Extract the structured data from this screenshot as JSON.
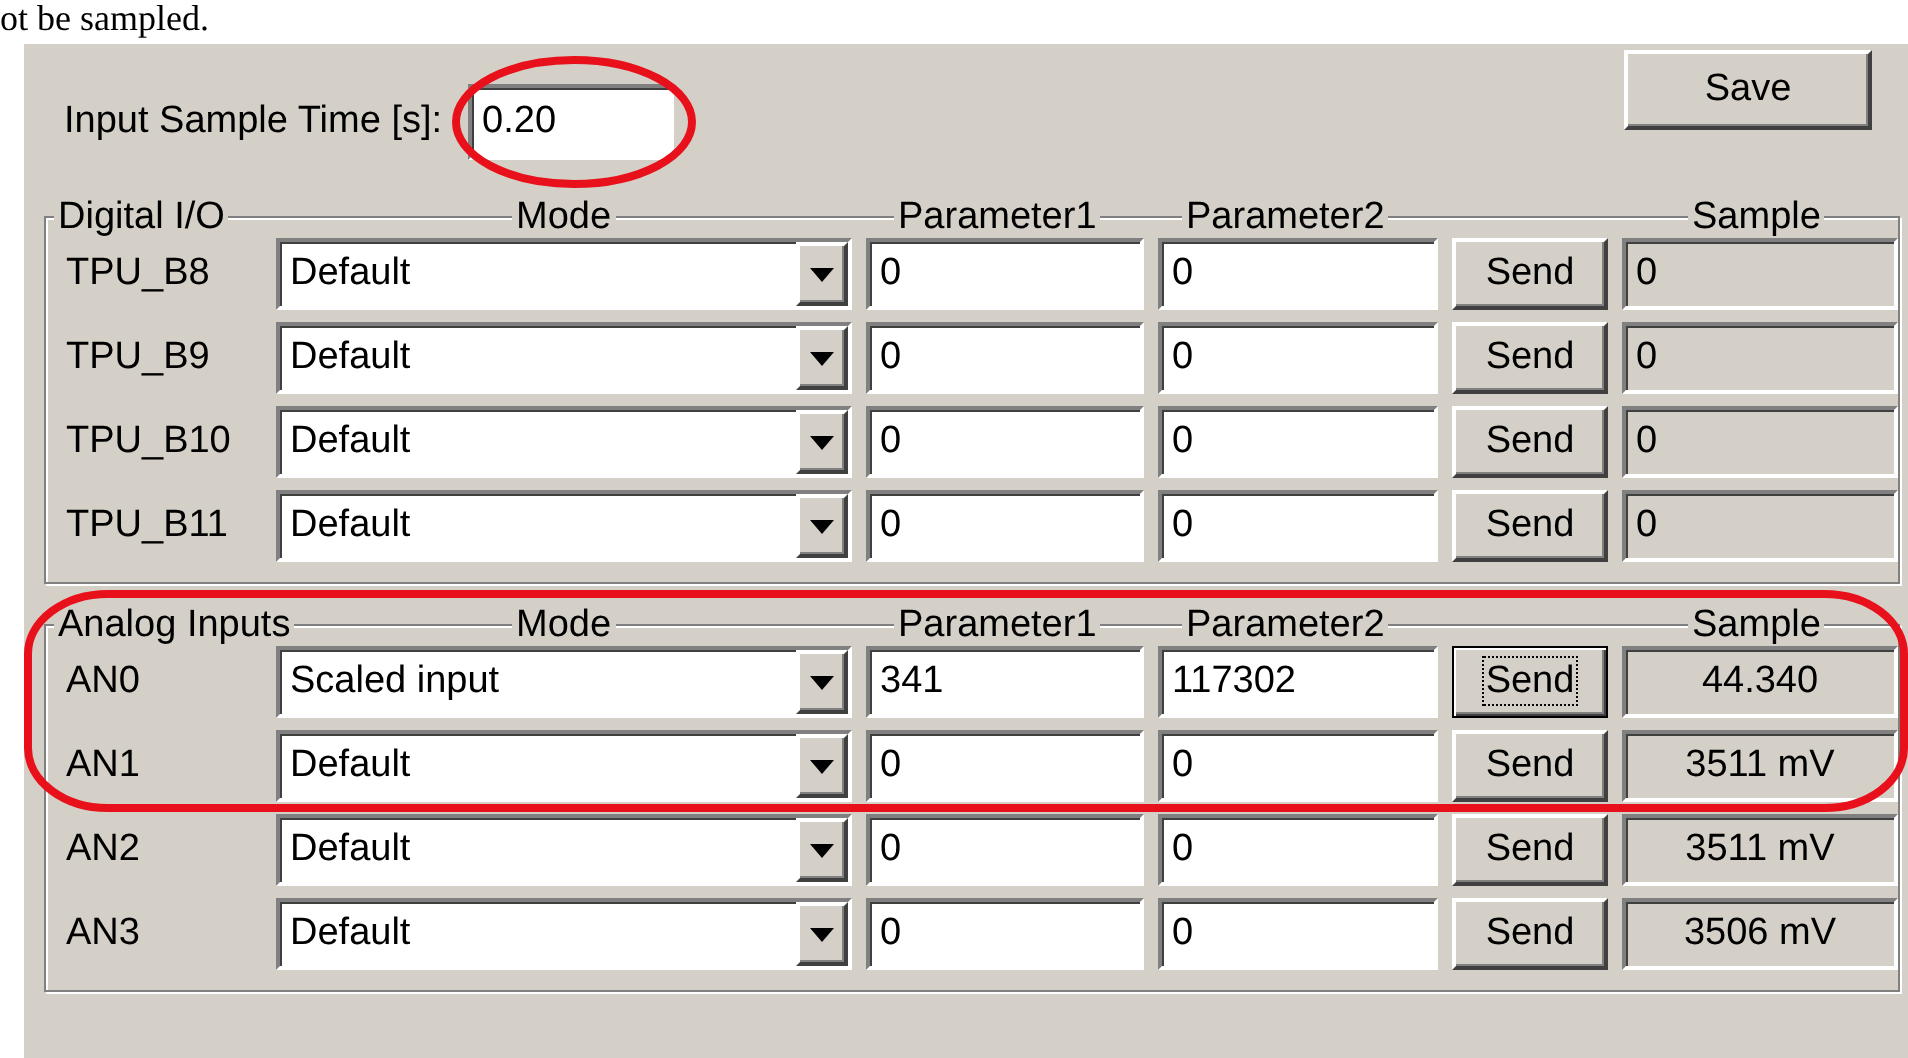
{
  "document_text": "ot be sampled.",
  "sample_time": {
    "label": "Input Sample Time [s]:",
    "value": "0.20"
  },
  "save_button": "Save",
  "groups": [
    {
      "kind": "digital",
      "title": "Digital I/O",
      "headers": [
        "Mode",
        "Parameter1",
        "Parameter2",
        "Sample"
      ],
      "rows": [
        {
          "label": "TPU_B8",
          "mode": "Default",
          "parameter1": "0",
          "parameter2": "0",
          "button": "Send",
          "focused": false,
          "sample": "0"
        },
        {
          "label": "TPU_B9",
          "mode": "Default",
          "parameter1": "0",
          "parameter2": "0",
          "button": "Send",
          "focused": false,
          "sample": "0"
        },
        {
          "label": "TPU_B10",
          "mode": "Default",
          "parameter1": "0",
          "parameter2": "0",
          "button": "Send",
          "focused": false,
          "sample": "0"
        },
        {
          "label": "TPU_B11",
          "mode": "Default",
          "parameter1": "0",
          "parameter2": "0",
          "button": "Send",
          "focused": false,
          "sample": "0"
        }
      ]
    },
    {
      "kind": "analog",
      "title": "Analog Inputs",
      "headers": [
        "Mode",
        "Parameter1",
        "Parameter2",
        "Sample"
      ],
      "rows": [
        {
          "label": "AN0",
          "mode": "Scaled input",
          "parameter1": "341",
          "parameter2": "117302",
          "button": "Send",
          "focused": true,
          "sample": "44.340"
        },
        {
          "label": "AN1",
          "mode": "Default",
          "parameter1": "0",
          "parameter2": "0",
          "button": "Send",
          "focused": false,
          "sample": "3511 mV"
        },
        {
          "label": "AN2",
          "mode": "Default",
          "parameter1": "0",
          "parameter2": "0",
          "button": "Send",
          "focused": false,
          "sample": "3511 mV"
        },
        {
          "label": "AN3",
          "mode": "Default",
          "parameter1": "0",
          "parameter2": "0",
          "button": "Send",
          "focused": false,
          "sample": "3506 mV"
        }
      ]
    }
  ],
  "annotations": [
    {
      "kind": "ellipse"
    },
    {
      "kind": "ellipse"
    }
  ]
}
